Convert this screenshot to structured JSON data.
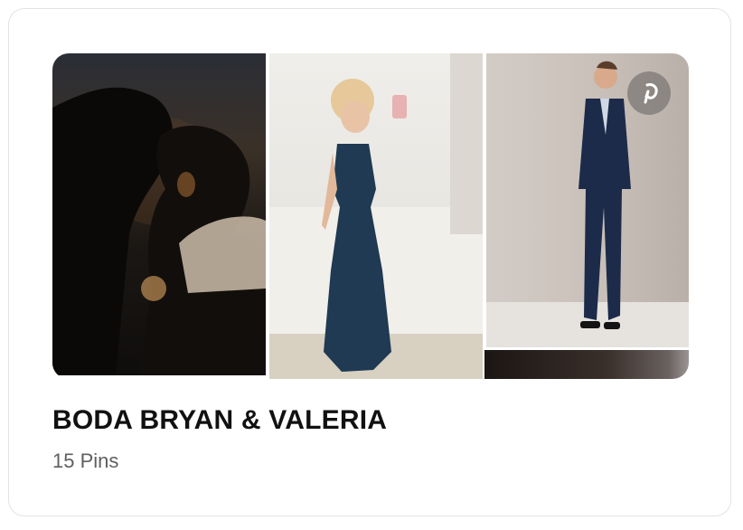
{
  "board": {
    "title": "BODA BRYAN & VALERIA",
    "pin_count": "15 Pins"
  },
  "collage": {
    "images": [
      {
        "name": "couple-silhouette-photo"
      },
      {
        "name": "navy-satin-dress-photo"
      },
      {
        "name": "navy-suit-man-photo"
      },
      {
        "name": "partial-dark-photo"
      }
    ]
  },
  "icons": {
    "pinterest": "pinterest-logo-icon"
  },
  "colors": {
    "title": "#111111",
    "subtitle": "#5f5f5f",
    "border": "#e3e3e3"
  }
}
